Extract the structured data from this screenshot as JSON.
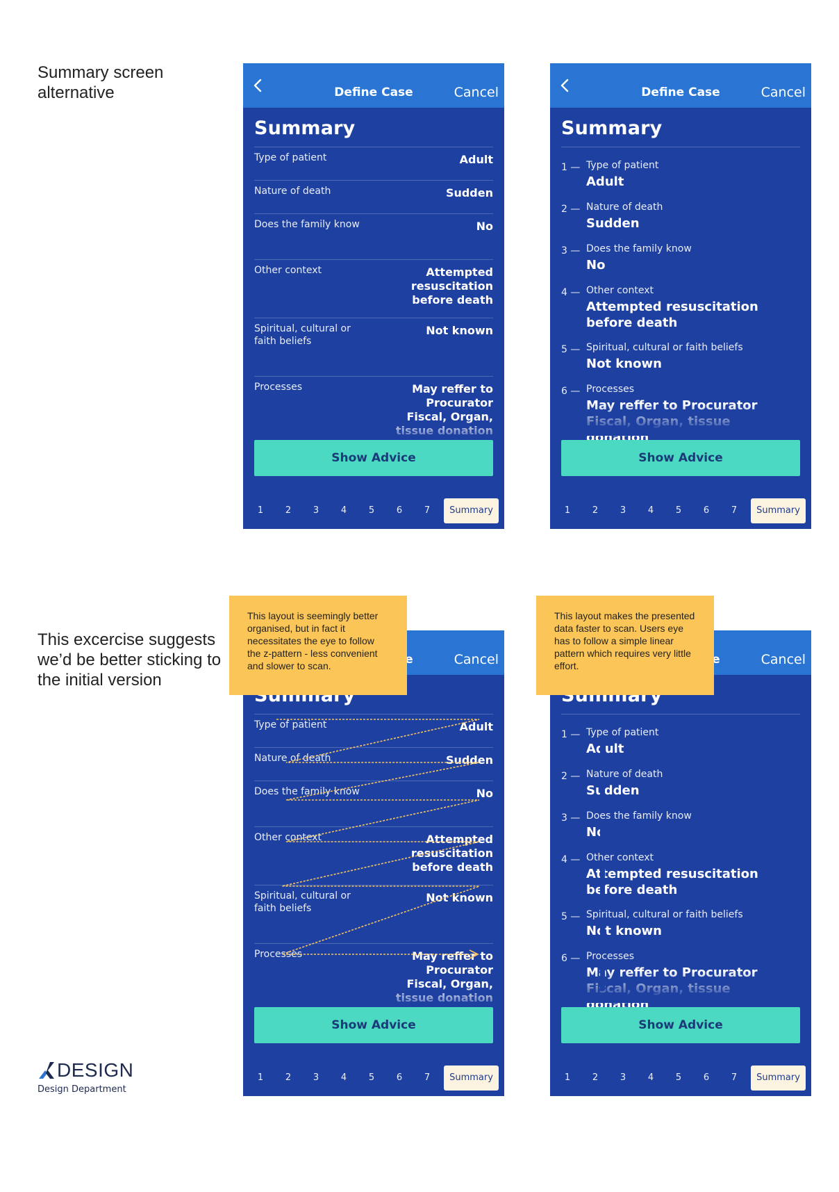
{
  "captions": {
    "top": "Summary screen alternative",
    "bottom": "This excercise suggests we’d be better sticking to the initial version"
  },
  "nav": {
    "title": "Define Case",
    "cancel": "Cancel",
    "back_icon": "chevron-left-icon"
  },
  "summary_title": "Summary",
  "items": [
    {
      "num": "1 —",
      "label": "Type of patient",
      "value": "Adult"
    },
    {
      "num": "2 —",
      "label": "Nature of death",
      "value": "Sudden"
    },
    {
      "num": "3 —",
      "label": "Does the family know",
      "value": "No"
    },
    {
      "num": "4 —",
      "label": "Other context",
      "value": "Attempted resuscitation before death"
    },
    {
      "num": "5 —",
      "label": "Spiritual, cultural or faith beliefs",
      "value": "Not known"
    },
    {
      "num": "6 —",
      "label": "Processes",
      "value": "May reffer to Procurator Fiscal, Organ, tissue donation"
    }
  ],
  "table_labels": {
    "row4_label_line1": "Spiritual, cultural or",
    "row4_label_line2": "faith beliefs"
  },
  "show_advice": "Show Advice",
  "pager": {
    "pages": [
      "1",
      "2",
      "3",
      "4",
      "5",
      "6",
      "7"
    ],
    "summary": "Summary",
    "active": "Summary"
  },
  "notes": {
    "left": "This layout is seemingly better organised, but in fact it necessitates the eye to follow the z-pattern - less convenient and slower to scan.",
    "right": "This layout makes the presented data faster to scan. Users eye has to follow a simple linear pattern which requires very little effort."
  },
  "logo": {
    "word": "DESIGN",
    "subtitle": "Design Department"
  },
  "colors": {
    "screen_bg": "#1e40a0",
    "navbar": "#2a75d3",
    "button": "#4bd9c1",
    "note": "#fbc657",
    "summary_tab": "#fdf3e1",
    "zpattern": "#f7c460"
  }
}
